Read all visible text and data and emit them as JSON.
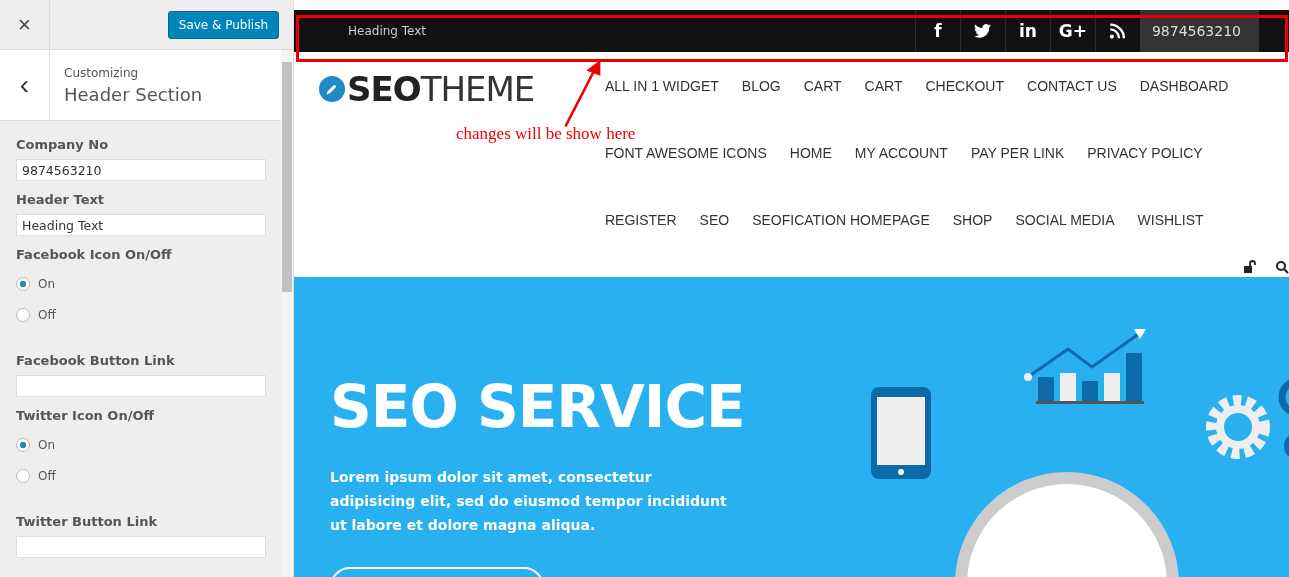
{
  "customizer": {
    "close": "×",
    "publish_button": "Save & Publish",
    "back": "‹",
    "breadcrumb": "Customizing",
    "section_title": "Header Section",
    "controls": [
      {
        "kind": "text",
        "label": "Company No",
        "value": "9874563210"
      },
      {
        "kind": "text",
        "label": "Header Text",
        "value": "Heading Text"
      },
      {
        "kind": "radio",
        "label": "Facebook Icon On/Off",
        "options": [
          {
            "label": "On",
            "selected": true
          },
          {
            "label": "Off",
            "selected": false
          }
        ]
      },
      {
        "kind": "text",
        "label": "Facebook Button Link"
      },
      {
        "kind": "radio",
        "label": "Twitter Icon On/Off",
        "options": [
          {
            "label": "On",
            "selected": true
          },
          {
            "label": "Off",
            "selected": false
          }
        ]
      },
      {
        "kind": "text",
        "label": "Twitter Button Link"
      }
    ]
  },
  "preview": {
    "top_bar": {
      "text": "Heading Text",
      "social": [
        {
          "kind": "facebook",
          "glyph": "f"
        },
        {
          "kind": "twitter"
        },
        {
          "kind": "linkedin",
          "glyph": "in"
        },
        {
          "kind": "googleplus",
          "glyph": "G+"
        },
        {
          "kind": "rss"
        }
      ],
      "phone": "9874563210"
    },
    "annotation": "changes will be show here",
    "logo": {
      "bold": "SEO",
      "light": "THEME"
    },
    "menu_rows": [
      [
        "ALL IN 1 WIDGET",
        "BLOG",
        "CART",
        "CART",
        "CHECKOUT",
        "CONTACT US",
        "DASHBOARD"
      ],
      [
        "FONT AWESOME ICONS",
        "HOME",
        "MY ACCOUNT",
        "PAY PER LINK",
        "PRIVACY POLICY"
      ],
      [
        "REGISTER",
        "SEO",
        "SEOFICATION HOMEPAGE",
        "SHOP",
        "SOCIAL MEDIA",
        "WISHLIST"
      ]
    ],
    "hero": {
      "title": "SEO SERVICE",
      "text": "Lorem ipsum dolor sit amet, consectetur adipisicing elit, sed do eiusmod tempor incididunt ut labore et dolore magna aliqua."
    }
  }
}
